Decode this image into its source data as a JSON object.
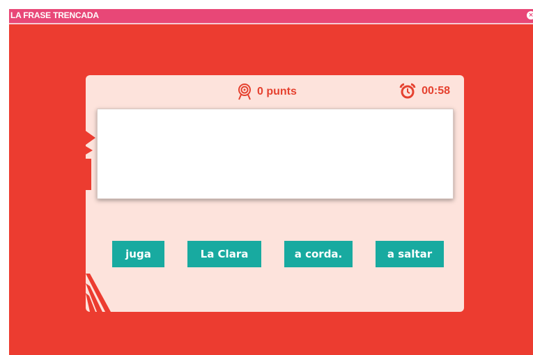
{
  "window": {
    "title": "LA FRASE TRENCADA",
    "close_glyph": "×"
  },
  "game": {
    "score_text": "0 punts",
    "score_icon": "target-icon",
    "timer_text": "00:58",
    "timer_icon": "alarm-clock-icon",
    "answer_text": ""
  },
  "words": [
    {
      "label": "juga"
    },
    {
      "label": "La Clara"
    },
    {
      "label": "a corda."
    },
    {
      "label": "a saltar"
    }
  ],
  "colors": {
    "background": "#ec3c30",
    "titlebar": "#e84777",
    "panel": "#fde3dc",
    "accent_text": "#e5412f",
    "word_button": "#18aaa0"
  }
}
